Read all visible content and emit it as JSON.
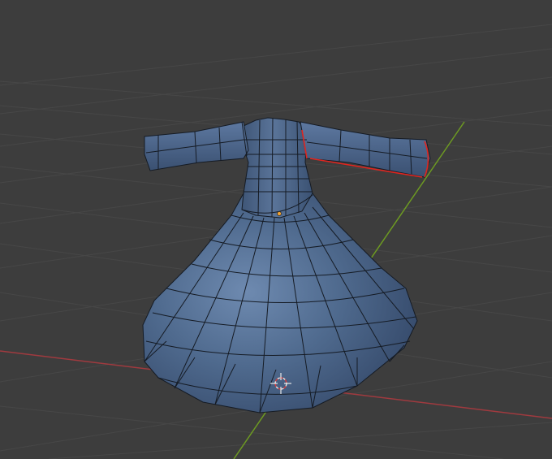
{
  "viewport": {
    "name": "3D Viewport",
    "background_color": "#3d3d3d",
    "grid_color": "#474747",
    "x_axis_color": "#a03a3f",
    "y_axis_color": "#6d9a22"
  },
  "object": {
    "shape": "dress mesh",
    "body_color": "#4c6585",
    "edge_color": "#151b24",
    "seam_color": "#e0251f",
    "origin_color": "#f2a230"
  },
  "cursor": {
    "icon": "3d-cursor-icon",
    "color": "#e8e8e8",
    "accent_color": "#d63c3c"
  }
}
